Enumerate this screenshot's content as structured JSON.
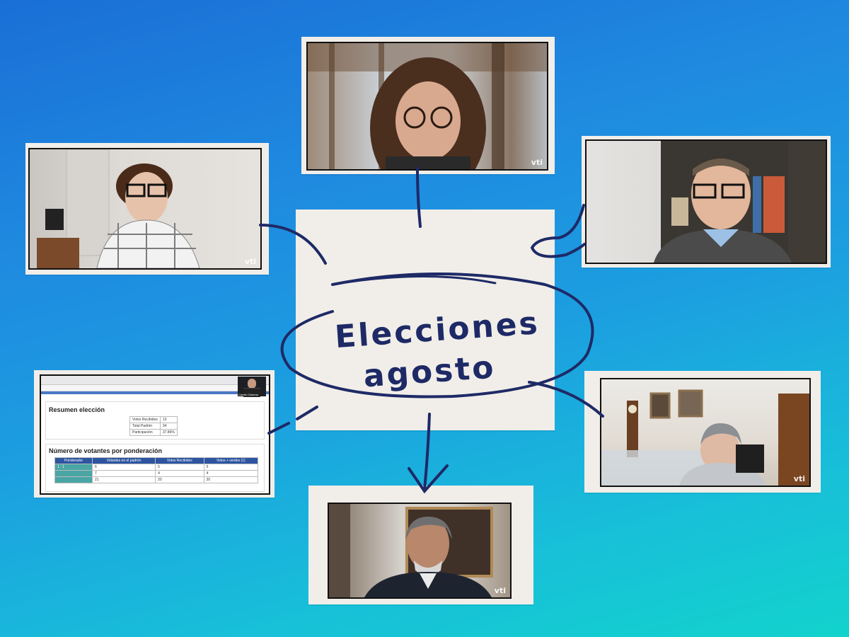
{
  "title": {
    "line1": "Elecciones",
    "line2": "agosto"
  },
  "watermark": "vti",
  "screen_share": {
    "section1": "Resumen elección",
    "summary_rows": [
      {
        "label": "Votos Recibidos",
        "value": "13"
      },
      {
        "label": "Total Padrón",
        "value": "34"
      },
      {
        "label": "Participación",
        "value": "37.86%"
      }
    ],
    "section2": "Número de votantes por ponderación",
    "table_headers": [
      "Ponderador",
      "Votantes en el padrón",
      "Votos Recibidos",
      "Votos + verdes (1)"
    ],
    "table_rows": [
      [
        "1 - 1",
        "6",
        "5",
        "5"
      ],
      [
        "",
        "7",
        "4",
        "4"
      ],
      [
        "",
        "21",
        "20",
        "20"
      ]
    ],
    "presenter_label": "Camilo Gamma"
  },
  "colors": {
    "ink": "#1e2a66",
    "paper": "#f1eee9",
    "bg_top": "#1a6fd6",
    "bg_bottom": "#12d3cc"
  }
}
